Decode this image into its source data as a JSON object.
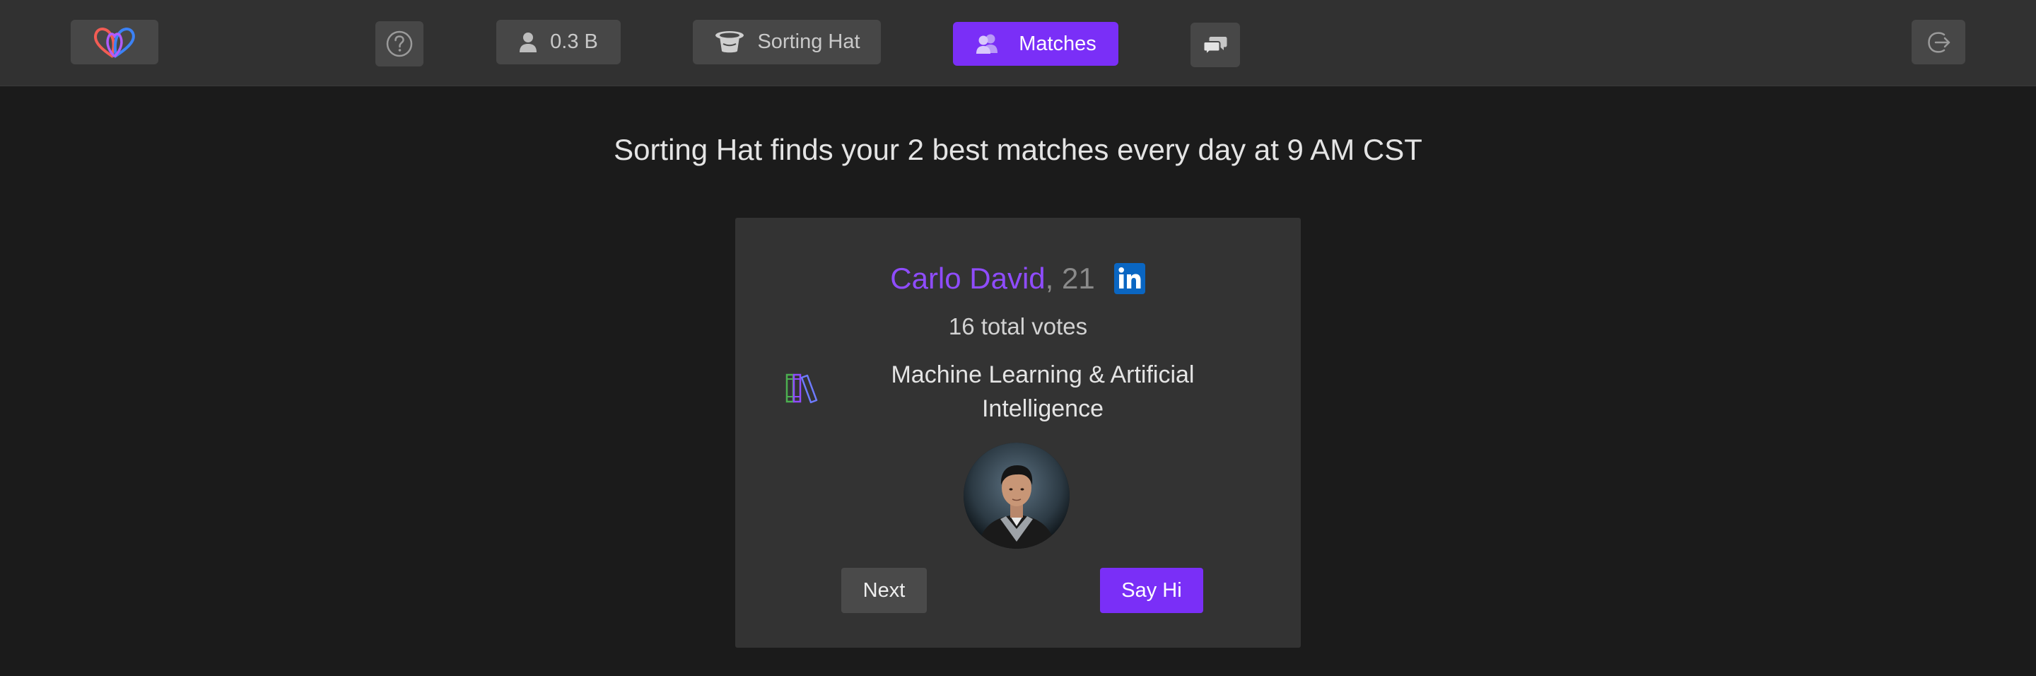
{
  "nav": {
    "logo_icon": "brand-hearts-logo",
    "help_icon": "question-circle-icon",
    "user_count": "0.3 B",
    "sorting_hat_label": "Sorting Hat",
    "matches_label": "Matches",
    "chat_icon": "chat-bubbles-icon",
    "logout_icon": "logout-icon",
    "accent_color": "#7a2ff7"
  },
  "main": {
    "headline": "Sorting Hat finds your 2 best matches every day at 9 AM CST"
  },
  "match_card": {
    "name": "Carlo David",
    "age_text": ", 21",
    "linkedin_icon": "linkedin-icon",
    "votes_text": "16 total votes",
    "field_icon": "books-icon",
    "field": "Machine Learning & Artificial Intelligence",
    "next_label": "Next",
    "say_hi_label": "Say Hi",
    "name_color": "#8f4cff"
  }
}
